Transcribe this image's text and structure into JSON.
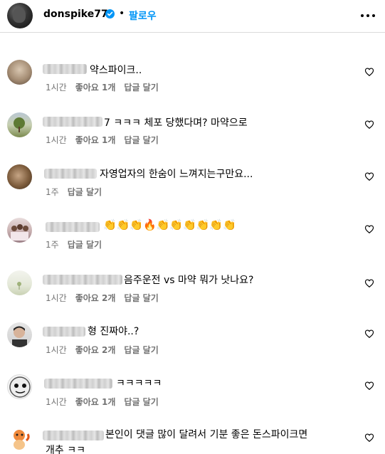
{
  "header": {
    "username": "donspike77",
    "separator": "•",
    "follow_label": "팔로우"
  },
  "comments": [
    {
      "text": "약스파이크..",
      "time": "1시간",
      "likes": "좋아요 1개",
      "reply": "답글 달기"
    },
    {
      "text": "7 ㅋㅋㅋ 체포 당했다며? 마약으로",
      "time": "1시간",
      "likes": "좋아요 1개",
      "reply": "답글 달기"
    },
    {
      "text": "자영업자의 한숨이 느껴지는구만요...",
      "time": "1주",
      "likes": "",
      "reply": "답글 달기"
    },
    {
      "text": "👏👏👏🔥👏👏👏👏👏👏",
      "time": "1주",
      "likes": "",
      "reply": "답글 달기"
    },
    {
      "text": "음주운전 vs 마약 뭐가 낫나요?",
      "time": "1시간",
      "likes": "좋아요 2개",
      "reply": "답글 달기"
    },
    {
      "text": "형 진짜야..?",
      "time": "1시간",
      "likes": "좋아요 2개",
      "reply": "답글 달기"
    },
    {
      "text": "ㅋㅋㅋㅋㅋ",
      "time": "1시간",
      "likes": "좋아요 1개",
      "reply": "답글 달기"
    },
    {
      "text": "본인이 댓글 많이 달려서 기분 좋은 돈스파이크면",
      "text2": "개추 ㅋㅋ"
    }
  ],
  "icons": {
    "verified": "verified-badge-icon",
    "more": "more-options-icon",
    "like": "heart-outline-icon"
  },
  "colors": {
    "accent": "#0095f6",
    "meta_text": "#737373",
    "divider": "#dbdbdb"
  }
}
